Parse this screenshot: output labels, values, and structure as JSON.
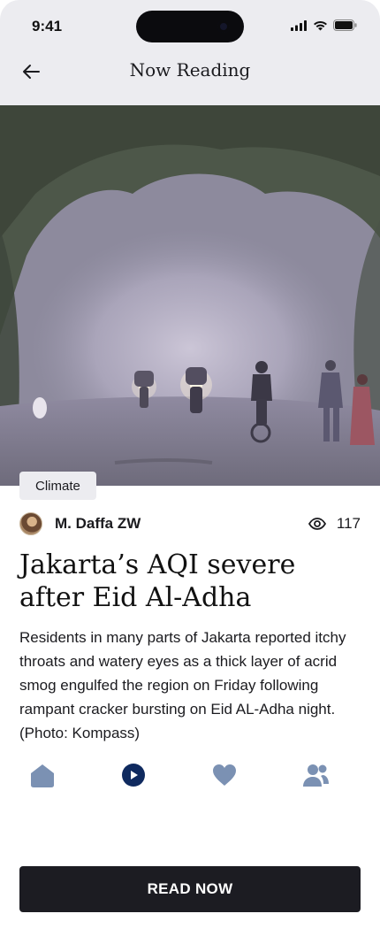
{
  "status_bar": {
    "time": "9:41"
  },
  "header": {
    "title": "Now Reading",
    "back_icon": "arrow-left-icon"
  },
  "article": {
    "category": "Climate",
    "author": "M. Daffa ZW",
    "views": "117",
    "title": "Jakarta’s AQI severe after Eid Al-Adha",
    "summary": "Residents in many parts of Jakarta reported itchy throats and watery eyes as a thick layer of acrid smog engulfed the region on Friday following rampant cracker bursting on Eid AL-Adha night. (Photo: Kompass)"
  },
  "nav": {
    "items": [
      {
        "icon": "home-icon",
        "active": false
      },
      {
        "icon": "play-icon",
        "active": true
      },
      {
        "icon": "heart-icon",
        "active": false
      },
      {
        "icon": "users-icon",
        "active": false
      }
    ],
    "colors": {
      "active": "#0f2a5f",
      "inactive": "#7b91b3"
    }
  },
  "cta": {
    "label": "READ NOW"
  }
}
